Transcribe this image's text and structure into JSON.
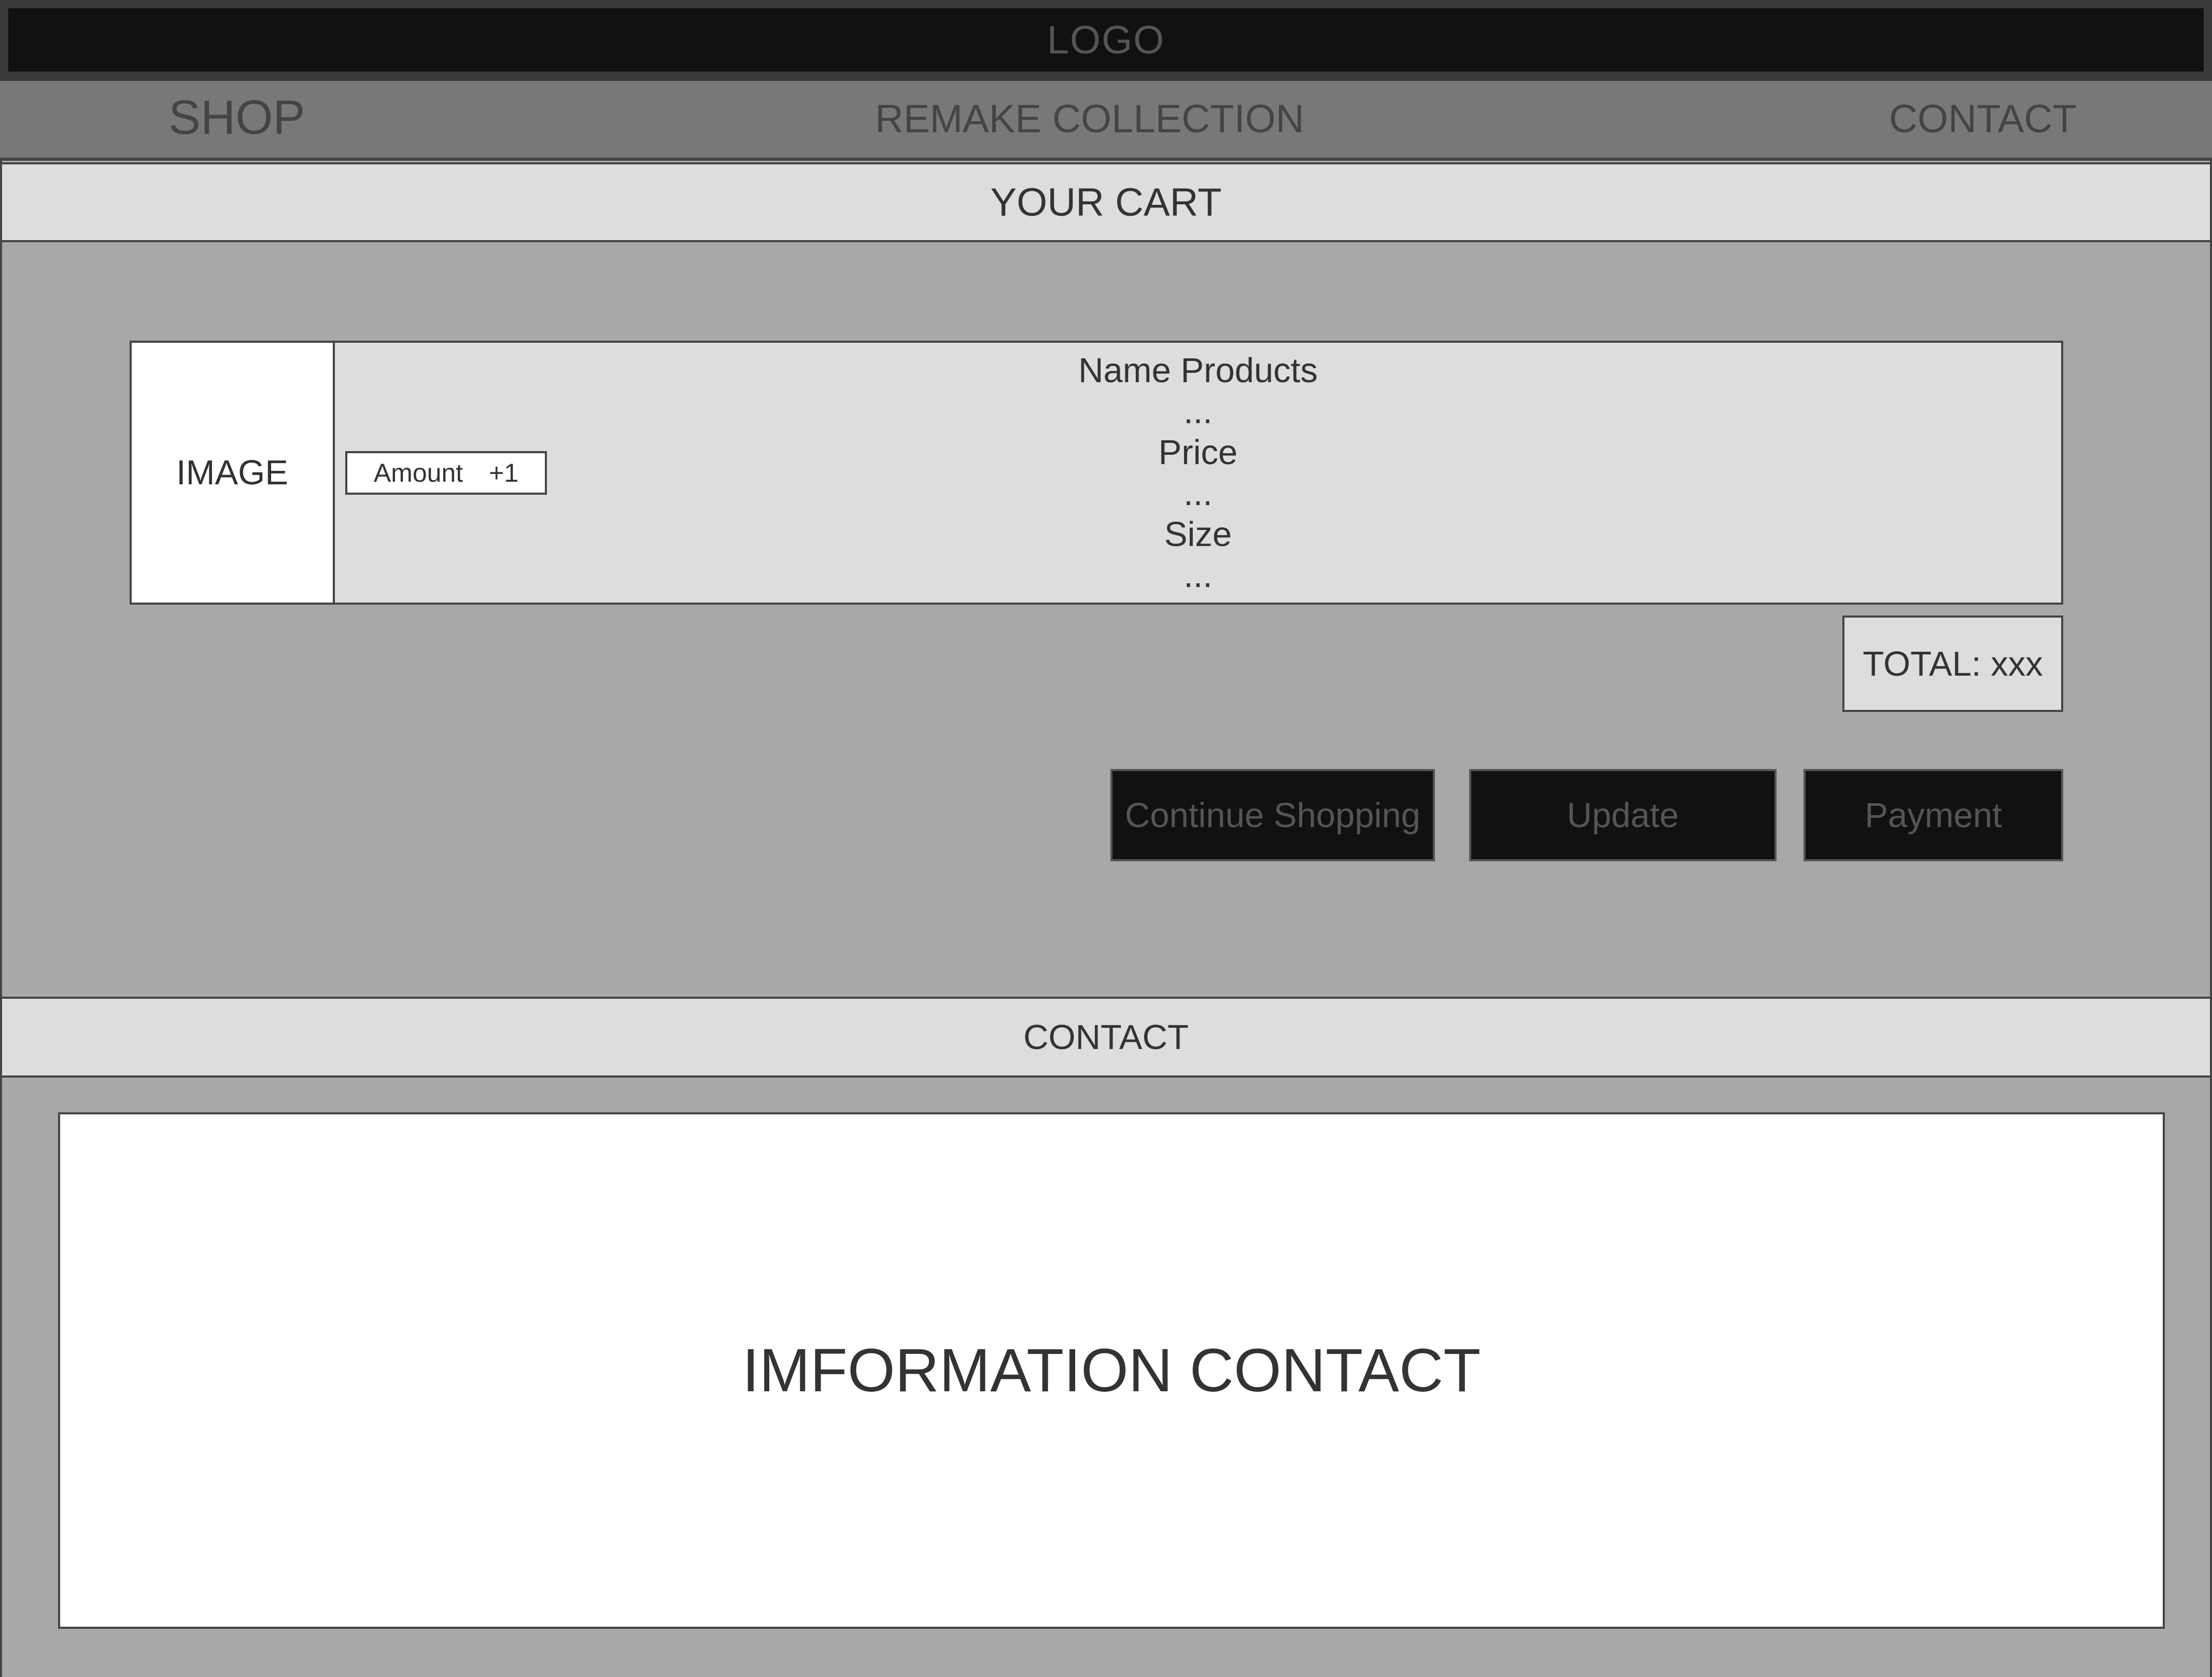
{
  "header": {
    "logo": "LOGO"
  },
  "nav": {
    "shop": "SHOP",
    "remake_collection": "REMAKE COLLECTION",
    "contact": "CONTACT"
  },
  "cart": {
    "title": "YOUR CART",
    "item": {
      "image_label": "IMAGE",
      "amount_label": "Amount",
      "increment_label": "+1",
      "details": [
        "Name Products",
        "...",
        "Price",
        "...",
        "Size",
        "..."
      ]
    },
    "total": "TOTAL: xxx",
    "buttons": {
      "continue_shopping": "Continue Shopping",
      "update": "Update",
      "payment": "Payment"
    }
  },
  "contact_section": {
    "title": "CONTACT",
    "info": "IMFORMATION CONTACT"
  },
  "colors": {
    "page_background": "#a8a8a8",
    "logo_bar": "#111111",
    "nav_bar": "#787878",
    "section_header": "#dddddd",
    "button_background": "#111111",
    "text": "#333333"
  }
}
